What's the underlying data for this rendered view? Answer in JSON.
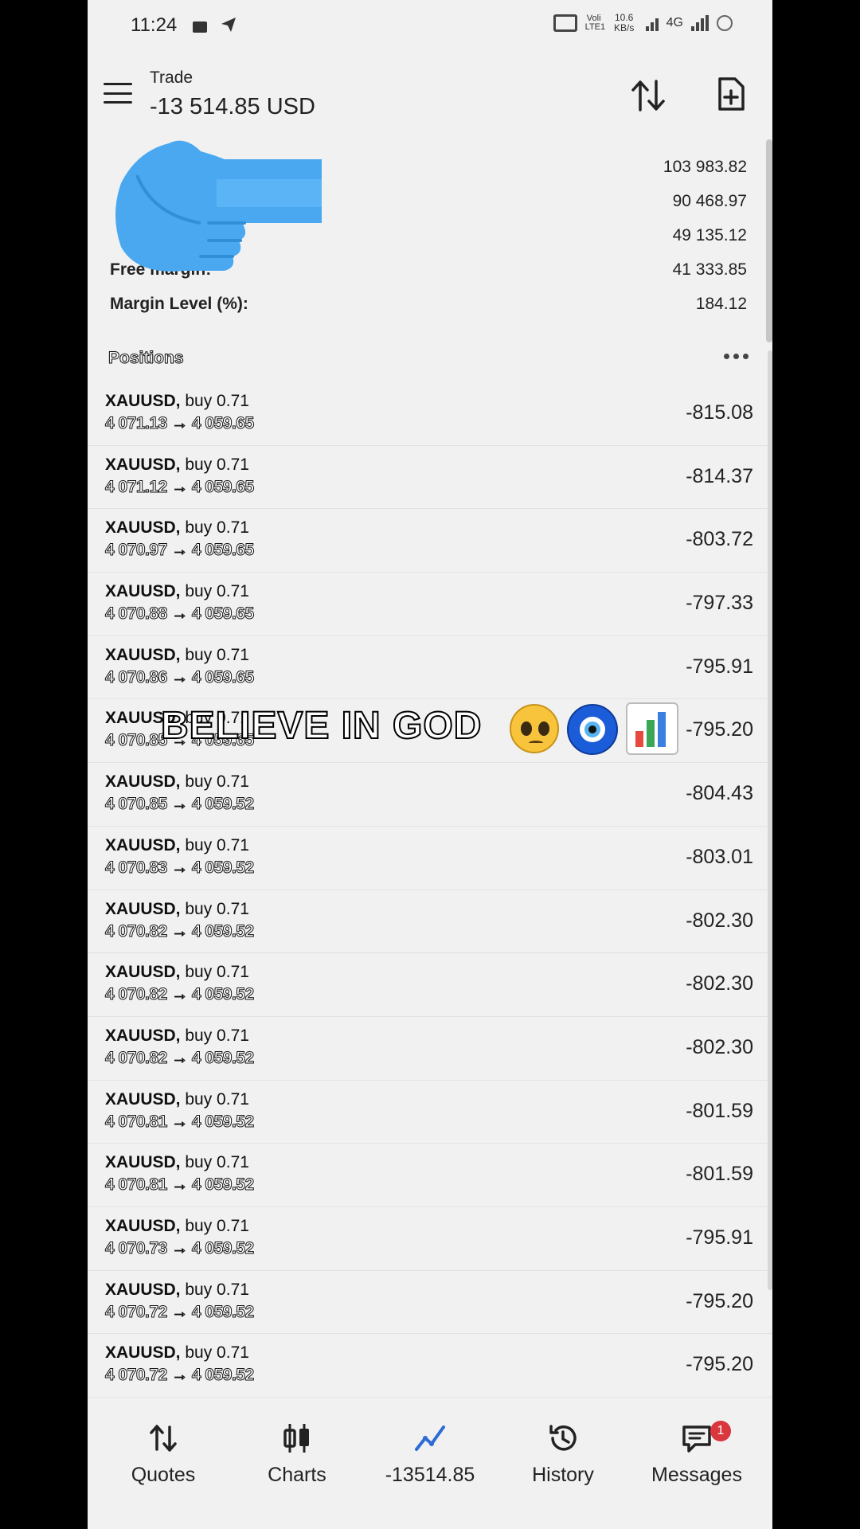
{
  "status_bar": {
    "time": "11:24",
    "volte": "Voli LTE1",
    "speed": "10.6 KB/s",
    "network": "4G"
  },
  "header": {
    "title": "Trade",
    "profit": "-13 514.85 USD"
  },
  "summary": {
    "rows": [
      {
        "label": "",
        "value": "103 983.82"
      },
      {
        "label": "",
        "value": "90 468.97"
      },
      {
        "label": "",
        "value": "49 135.12"
      },
      {
        "label": "Free margin:",
        "value": "41 333.85"
      },
      {
        "label": "Margin Level (%):",
        "value": "184.12"
      }
    ]
  },
  "positions": {
    "title": "Positions",
    "items": [
      {
        "symbol": "XAUUSD,",
        "side": "buy 0.71",
        "prices": "4 071.13 → 4 059.65",
        "profit": "-815.08"
      },
      {
        "symbol": "XAUUSD,",
        "side": "buy 0.71",
        "prices": "4 071.12 → 4 059.65",
        "profit": "-814.37"
      },
      {
        "symbol": "XAUUSD,",
        "side": "buy 0.71",
        "prices": "4 070.97 → 4 059.65",
        "profit": "-803.72"
      },
      {
        "symbol": "XAUUSD,",
        "side": "buy 0.71",
        "prices": "4 070.88 → 4 059.65",
        "profit": "-797.33"
      },
      {
        "symbol": "XAUUSD,",
        "side": "buy 0.71",
        "prices": "4 070.86 → 4 059.65",
        "profit": "-795.91"
      },
      {
        "symbol": "XAUUSD,",
        "side": "buy 0.71",
        "prices": "4 070.85 → 4 059.65",
        "profit": "-795.20"
      },
      {
        "symbol": "XAUUSD,",
        "side": "buy 0.71",
        "prices": "4 070.85 → 4 059.52",
        "profit": "-804.43"
      },
      {
        "symbol": "XAUUSD,",
        "side": "buy 0.71",
        "prices": "4 070.83 → 4 059.52",
        "profit": "-803.01"
      },
      {
        "symbol": "XAUUSD,",
        "side": "buy 0.71",
        "prices": "4 070.82 → 4 059.52",
        "profit": "-802.30"
      },
      {
        "symbol": "XAUUSD,",
        "side": "buy 0.71",
        "prices": "4 070.82 → 4 059.52",
        "profit": "-802.30"
      },
      {
        "symbol": "XAUUSD,",
        "side": "buy 0.71",
        "prices": "4 070.82 → 4 059.52",
        "profit": "-802.30"
      },
      {
        "symbol": "XAUUSD,",
        "side": "buy 0.71",
        "prices": "4 070.81 → 4 059.52",
        "profit": "-801.59"
      },
      {
        "symbol": "XAUUSD,",
        "side": "buy 0.71",
        "prices": "4 070.81 → 4 059.52",
        "profit": "-801.59"
      },
      {
        "symbol": "XAUUSD,",
        "side": "buy 0.71",
        "prices": "4 070.73 → 4 059.52",
        "profit": "-795.91"
      },
      {
        "symbol": "XAUUSD,",
        "side": "buy 0.71",
        "prices": "4 070.72 → 4 059.52",
        "profit": "-795.20"
      },
      {
        "symbol": "XAUUSD,",
        "side": "buy 0.71",
        "prices": "4 070.72 → 4 059.52",
        "profit": "-795.20"
      }
    ]
  },
  "caption": {
    "text": "BELIEVE IN GOD"
  },
  "nav": {
    "quotes": "Quotes",
    "charts": "Charts",
    "trade": "-13514.85",
    "history": "History",
    "messages": "Messages",
    "messages_badge": "1"
  },
  "colors": {
    "background": "#f1f1f1",
    "accent": "#2e6bd6",
    "badge": "#d9363e",
    "hand": "#4aa8f0"
  }
}
